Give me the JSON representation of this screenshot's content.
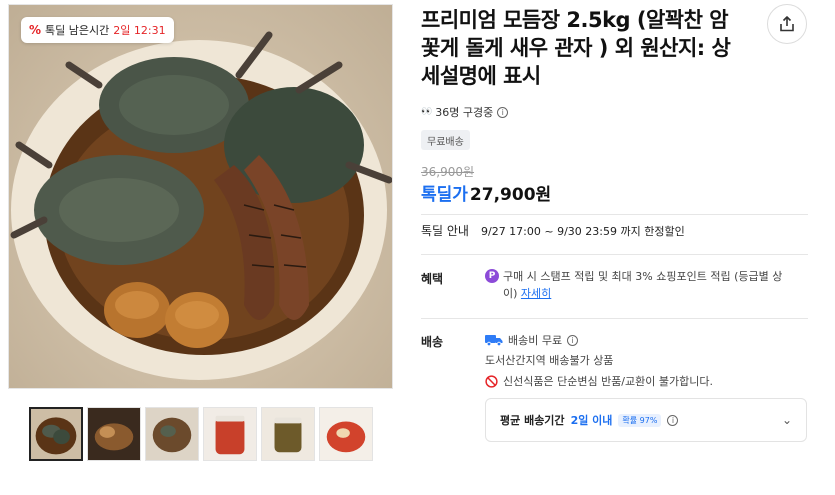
{
  "badge": {
    "label": "톡딜 남은시간",
    "time": "2일 12:31"
  },
  "product": {
    "title": "프리미엄 모듬장 2.5kg (알꽉찬 암 꽃게 돌게 새우 관자 ) 외 원산지: 상세설명에 표시",
    "viewers": "36명 구경중",
    "free_shipping_tag": "무료배송",
    "original_price": "36,900원",
    "deal_label": "톡딜가",
    "price": "27,900원"
  },
  "deal_info": {
    "label": "톡딜 안내",
    "period": "9/27 17:00 ~ 9/30 23:59 까지 한정할인"
  },
  "benefit": {
    "label": "혜택",
    "icon_letter": "P",
    "text": "구매 시 스탬프 적립 및 최대 3% 쇼핑포인트 적립 (등급별 상이)",
    "link": "자세히"
  },
  "shipping": {
    "label": "배송",
    "fee": "배송비 무료",
    "restriction": "도서산간지역 배송불가 상품",
    "notice": "신선식품은 단순변심 반품/교환이 불가합니다.",
    "delivery_label": "평균 배송기간",
    "delivery_value": "2일 이내",
    "probability": "확률 97%"
  },
  "icons": {
    "share": "share-icon",
    "info": "info-icon",
    "truck": "truck-icon",
    "ban": "ban-icon",
    "chevron": "chevron-down-icon"
  },
  "colors": {
    "accent": "#1c6ff0",
    "deal_red": "#e52528",
    "point_purple": "#8c4bd8"
  }
}
